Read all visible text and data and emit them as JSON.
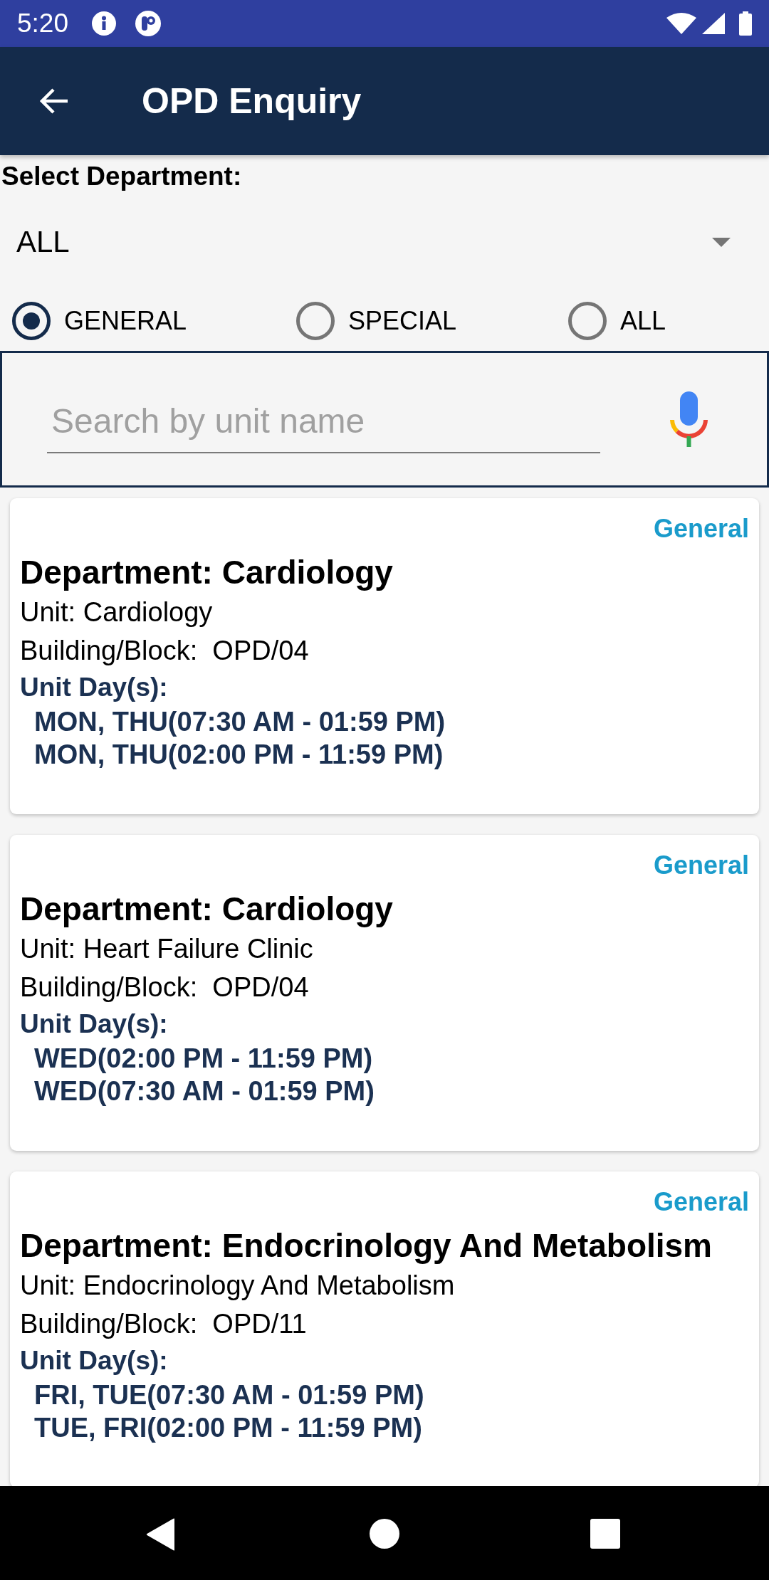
{
  "status_bar": {
    "time": "5:20"
  },
  "app_bar": {
    "title": "OPD Enquiry"
  },
  "filter": {
    "label": "Select Department:",
    "department": "ALL",
    "types": [
      {
        "label": "GENERAL",
        "selected": true
      },
      {
        "label": "SPECIAL",
        "selected": false
      },
      {
        "label": "ALL",
        "selected": false
      }
    ]
  },
  "search": {
    "placeholder": "Search by unit name"
  },
  "units": [
    {
      "category": "General",
      "department": "Department: Cardiology",
      "unit": "Unit: Cardiology",
      "building": "Building/Block:  OPD/04",
      "days_label": "Unit Day(s):",
      "schedules": [
        "MON, THU(07:30 AM - 01:59 PM)",
        "MON, THU(02:00 PM - 11:59 PM)"
      ]
    },
    {
      "category": "General",
      "department": "Department: Cardiology",
      "unit": "Unit: Heart Failure Clinic",
      "building": "Building/Block:  OPD/04",
      "days_label": "Unit Day(s):",
      "schedules": [
        "WED(02:00 PM - 11:59 PM)",
        "WED(07:30 AM - 01:59 PM)"
      ]
    },
    {
      "category": "General",
      "department": "Department: Endocrinology And Metabolism",
      "unit": "Unit: Endocrinology And Metabolism",
      "building": "Building/Block:  OPD/11",
      "days_label": "Unit Day(s):",
      "schedules": [
        "FRI, TUE(07:30 AM - 01:59 PM)",
        "TUE, FRI(02:00 PM - 11:59 PM)"
      ]
    }
  ]
}
